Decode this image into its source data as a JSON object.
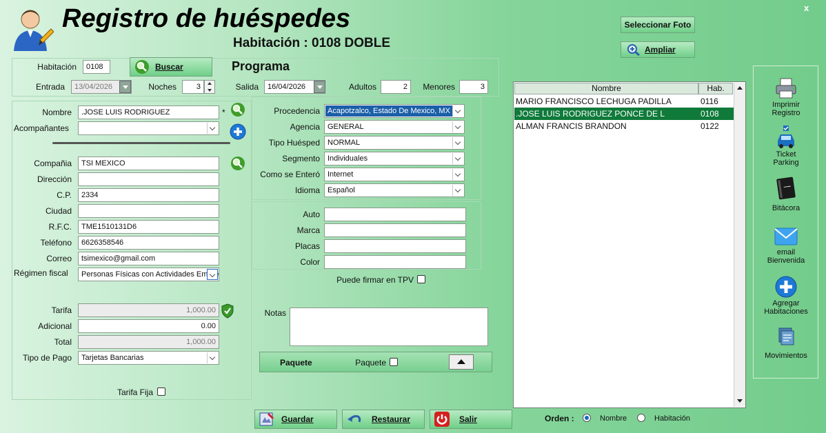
{
  "header": {
    "title": "Registro de huéspedes",
    "room_line": "Habitación : 0108 DOBLE",
    "select_photo": "Seleccionar Foto",
    "zoom": "Ampliar",
    "close": "x"
  },
  "top": {
    "habitacion_label": "Habitación",
    "habitacion_value": "0108",
    "buscar": "Buscar",
    "programa": "Programa",
    "entrada_label": "Entrada",
    "entrada_value": "13/04/2026",
    "noches_label": "Noches",
    "noches_value": "3",
    "salida_label": "Salida",
    "salida_value": "16/04/2026",
    "adultos_label": "Adultos",
    "adultos_value": "2",
    "menores_label": "Menores",
    "menores_value": "3"
  },
  "guest": {
    "nombre_label": "Nombre",
    "nombre_value": ".JOSE LUIS RODRIGUEZ",
    "required_mark": "*",
    "acompanantes_label": "Acompañantes",
    "acompanantes_value": "",
    "compania_label": "Compañia",
    "compania_value": "TSI MEXICO",
    "direccion_label": "Dirección",
    "direccion_value": "",
    "cp_label": "C.P.",
    "cp_value": "2334",
    "ciudad_label": "Ciudad",
    "ciudad_value": "",
    "rfc_label": "R.F.C.",
    "rfc_value": "TME1510131D6",
    "telefono_label": "Teléfono",
    "telefono_value": "6626358546",
    "correo_label": "Correo",
    "correo_value": "tsimexico@gmail.com",
    "regimen_label": "Régimen fiscal",
    "regimen_value": "Personas Físicas con Actividades Empresariales"
  },
  "rates": {
    "tarifa_label": "Tarifa",
    "tarifa_value": "1,000.00",
    "adicional_label": "Adicional",
    "adicional_value": "0.00",
    "total_label": "Total",
    "total_value": "1,000.00",
    "tipo_pago_label": "Tipo de Pago",
    "tipo_pago_value": "Tarjetas Bancarias",
    "tarifa_fija_label": "Tarifa Fija"
  },
  "middle": {
    "procedencia_label": "Procedencia",
    "procedencia_value": "Acapotzalco, Estado De Mexico, MX",
    "agencia_label": "Agencia",
    "agencia_value": "GENERAL",
    "tipo_huesped_label": "Tipo Huésped",
    "tipo_huesped_value": "NORMAL",
    "segmento_label": "Segmento",
    "segmento_value": "Individuales",
    "como_label": "Como se Enteró",
    "como_value": "Internet",
    "idioma_label": "Idioma",
    "idioma_value": "Español",
    "auto_label": "Auto",
    "auto_value": "",
    "marca_label": "Marca",
    "marca_value": "",
    "placas_label": "Placas",
    "placas_value": "",
    "color_label": "Color",
    "color_value": "",
    "tpv_label": "Puede firmar en TPV",
    "notas_label": "Notas",
    "notas_value": "",
    "paquete_title": "Paquete",
    "paquete_check_label": "Paquete"
  },
  "bottom": {
    "guardar": "Guardar",
    "restaurar": "Restaurar",
    "salir": "Salir",
    "orden_label": "Orden :",
    "orden_nombre": "Nombre",
    "orden_habitacion": "Habitación"
  },
  "guest_list": {
    "columns": [
      "Nombre",
      "Hab."
    ],
    "rows": [
      {
        "name": " MARIO FRANCISCO LECHUGA PADILLA",
        "room": "0116"
      },
      {
        "name": ".JOSE LUIS RODRIGUEZ PONCE DE L",
        "room": "0108"
      },
      {
        "name": "ALMAN FRANCIS BRANDON",
        "room": "0122"
      }
    ]
  },
  "sidebar": {
    "imprimir": "Imprimir Registro",
    "ticket": "Ticket Parking",
    "bitacora": "Bitácora",
    "email": "email Bienvenida",
    "agregar": "Agregar Habitaciones",
    "movimientos": "Movimientos"
  },
  "colors": {
    "selected_row": "#0f7a3a",
    "highlight_field": "#1b5fa8",
    "accent_blue": "#1e79d6"
  }
}
